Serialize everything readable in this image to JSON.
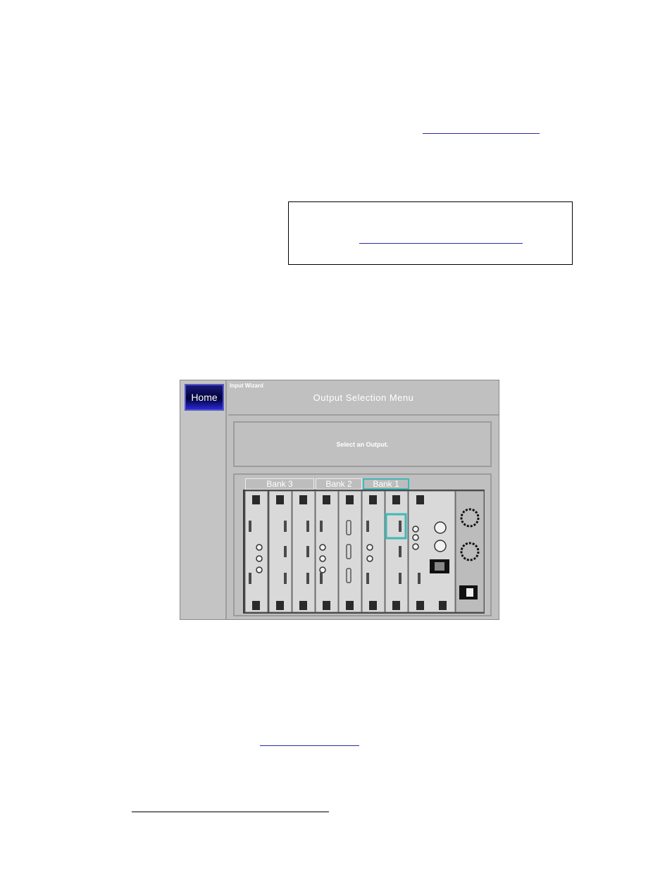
{
  "window": {
    "home_label": "Home",
    "wizard_label": "Input Wizard",
    "title": "Output Selection Menu",
    "message": "Select an Output."
  },
  "tabs": [
    {
      "label": "Bank 3",
      "active": false
    },
    {
      "label": "Bank 2",
      "active": false
    },
    {
      "label": "Bank 1",
      "active": true
    }
  ],
  "colors": {
    "accent": "#40b8b8",
    "home_button": "#000038",
    "panel": "#c0c0c0"
  }
}
